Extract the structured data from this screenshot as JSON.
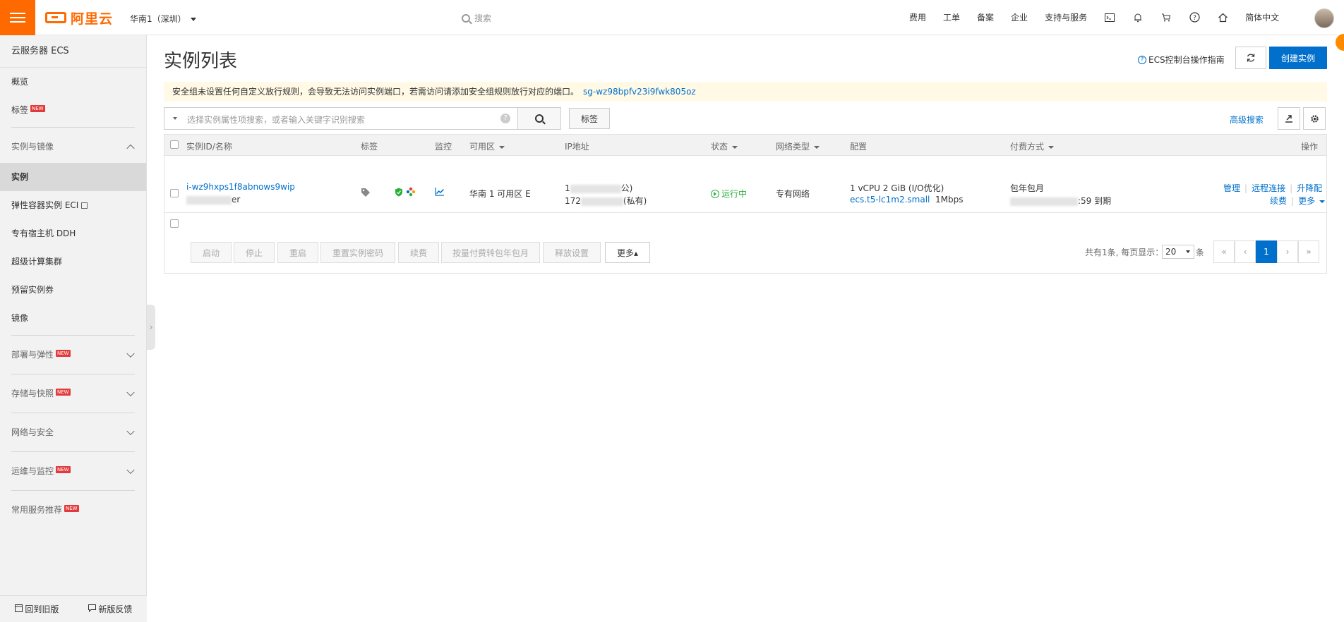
{
  "header": {
    "brand": "阿里云",
    "region": "华南1（深圳）",
    "search_placeholder": "搜索",
    "nav": [
      "费用",
      "工单",
      "备案",
      "企业",
      "支持与服务"
    ],
    "language": "简体中文"
  },
  "sidebar": {
    "title": "云服务器 ECS",
    "items": [
      {
        "label": "概览"
      },
      {
        "label": "标签",
        "badge": "NEW"
      }
    ],
    "group_instances": "实例与镜像",
    "sub_items": [
      {
        "label": "实例",
        "active": true
      },
      {
        "label": "弹性容器实例 ECI"
      },
      {
        "label": "专有宿主机 DDH"
      },
      {
        "label": "超级计算集群"
      },
      {
        "label": "预留实例券"
      },
      {
        "label": "镜像"
      }
    ],
    "groups": [
      {
        "label": "部署与弹性",
        "badge": "NEW"
      },
      {
        "label": "存储与快照",
        "badge": "NEW"
      },
      {
        "label": "网络与安全"
      },
      {
        "label": "运维与监控",
        "badge": "NEW"
      }
    ],
    "recommend": {
      "label": "常用服务推荐",
      "badge": "NEW"
    },
    "footer": {
      "old_version": "回到旧版",
      "feedback": "新版反馈"
    }
  },
  "main": {
    "title": "实例列表",
    "guide_link": "ECS控制台操作指南",
    "create_button": "创建实例",
    "notice_text": "安全组未设置任何自定义放行规则，会导致无法访问实例端口，若需访问请添加安全组规则放行对应的端口。",
    "notice_link": "sg-wz98bpfv23i9fwk805oz",
    "filter_placeholder": "选择实例属性项搜索，或者输入关键字识别搜索",
    "tag_button": "标签",
    "advanced_search": "高级搜索"
  },
  "table": {
    "columns": [
      "实例ID/名称",
      "标签",
      "监控",
      "可用区",
      "IP地址",
      "状态",
      "网络类型",
      "配置",
      "付费方式",
      "操作"
    ],
    "rows": [
      {
        "instance_id": "i-wz9hxps1f8abnows9wip",
        "name_suffix": "er",
        "zone": "华南 1 可用区 E",
        "ip_public_prefix": "1",
        "ip_public_suffix": "公)",
        "ip_private_prefix": "172",
        "ip_private_suffix": "(私有)",
        "status": "运行中",
        "network": "专有网络",
        "config_line1": "1 vCPU 2 GiB (I/O优化)",
        "config_type": "ecs.t5-lc1m2.small",
        "bandwidth": "1Mbps",
        "billing": "包年包月",
        "expire_suffix": ":59 到期",
        "actions": [
          "管理",
          "远程连接",
          "升降配"
        ],
        "actions2": [
          "续费",
          "更多"
        ]
      }
    ],
    "bulk_actions": [
      "启动",
      "停止",
      "重启",
      "重置实例密码",
      "续费",
      "按量付费转包年包月",
      "释放设置"
    ],
    "more_button": "更多▴",
    "pagination": {
      "summary": "共有1条, 每页显示：",
      "page_size": "20",
      "unit": "条",
      "first": "«",
      "prev": "‹",
      "current": "1",
      "next": "›",
      "last": "»"
    }
  },
  "colors": {
    "brand_orange": "#ff6a00",
    "primary_blue": "#0070cc",
    "running_green": "#2aaf3d",
    "notice_bg": "#fff9e6"
  }
}
